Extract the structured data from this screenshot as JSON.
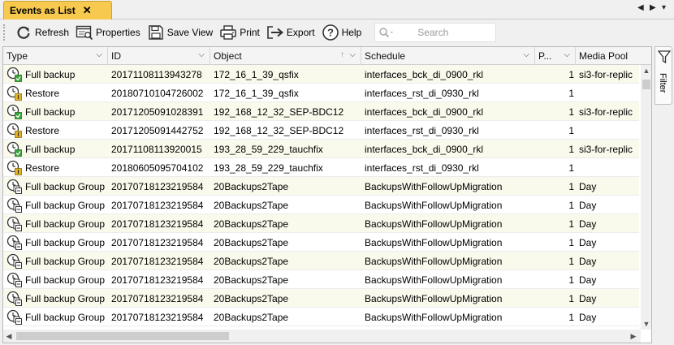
{
  "tab": {
    "title": "Events as List",
    "close_glyph": "✕"
  },
  "tabnav": {
    "prev": "◀",
    "next": "▶",
    "menu": "▾"
  },
  "toolbar": {
    "refresh_label": "Refresh",
    "properties_label": "Properties",
    "save_view_label": "Save View",
    "print_label": "Print",
    "export_label": "Export",
    "help_label": "Help",
    "search_placeholder": "Search"
  },
  "columns": [
    "Type",
    "ID",
    "Object",
    "Schedule",
    "P...",
    "Media Pool"
  ],
  "rows": [
    {
      "type": "Full backup",
      "icon": "backup",
      "id": "20171108113943278",
      "object": "172_16_1_39_qsfix",
      "schedule": "interfaces_bck_di_0900_rkl",
      "p": "1",
      "pool": "si3-for-replic"
    },
    {
      "type": "Restore",
      "icon": "restore",
      "id": "20180710104726002",
      "object": "172_16_1_39_qsfix",
      "schedule": "interfaces_rst_di_0930_rkl",
      "p": "1",
      "pool": ""
    },
    {
      "type": "Full backup",
      "icon": "backup",
      "id": "20171205091028391",
      "object": "192_168_12_32_SEP-BDC12",
      "schedule": "interfaces_bck_di_0900_rkl",
      "p": "1",
      "pool": "si3-for-replic"
    },
    {
      "type": "Restore",
      "icon": "restore",
      "id": "20171205091442752",
      "object": "192_168_12_32_SEP-BDC12",
      "schedule": "interfaces_rst_di_0930_rkl",
      "p": "1",
      "pool": ""
    },
    {
      "type": "Full backup",
      "icon": "backup",
      "id": "20171108113920015",
      "object": "193_28_59_229_tauchfix",
      "schedule": "interfaces_bck_di_0900_rkl",
      "p": "1",
      "pool": "si3-for-replic"
    },
    {
      "type": "Restore",
      "icon": "restore",
      "id": "20180605095704102",
      "object": "193_28_59_229_tauchfix",
      "schedule": "interfaces_rst_di_0930_rkl",
      "p": "1",
      "pool": ""
    },
    {
      "type": "Full backup Group",
      "icon": "group",
      "id": "20170718123219584",
      "object": "20Backups2Tape",
      "schedule": "BackupsWithFollowUpMigration",
      "p": "1",
      "pool": "Day"
    },
    {
      "type": "Full backup Group",
      "icon": "group",
      "id": "20170718123219584",
      "object": "20Backups2Tape",
      "schedule": "BackupsWithFollowUpMigration",
      "p": "1",
      "pool": "Day"
    },
    {
      "type": "Full backup Group",
      "icon": "group",
      "id": "20170718123219584",
      "object": "20Backups2Tape",
      "schedule": "BackupsWithFollowUpMigration",
      "p": "1",
      "pool": "Day"
    },
    {
      "type": "Full backup Group",
      "icon": "group",
      "id": "20170718123219584",
      "object": "20Backups2Tape",
      "schedule": "BackupsWithFollowUpMigration",
      "p": "1",
      "pool": "Day"
    },
    {
      "type": "Full backup Group",
      "icon": "group",
      "id": "20170718123219584",
      "object": "20Backups2Tape",
      "schedule": "BackupsWithFollowUpMigration",
      "p": "1",
      "pool": "Day"
    },
    {
      "type": "Full backup Group",
      "icon": "group",
      "id": "20170718123219584",
      "object": "20Backups2Tape",
      "schedule": "BackupsWithFollowUpMigration",
      "p": "1",
      "pool": "Day"
    },
    {
      "type": "Full backup Group",
      "icon": "group",
      "id": "20170718123219584",
      "object": "20Backups2Tape",
      "schedule": "BackupsWithFollowUpMigration",
      "p": "1",
      "pool": "Day"
    },
    {
      "type": "Full backup Group",
      "icon": "group",
      "id": "20170718123219584",
      "object": "20Backups2Tape",
      "schedule": "BackupsWithFollowUpMigration",
      "p": "1",
      "pool": "Day"
    }
  ],
  "filter_panel": {
    "label": "Filter"
  },
  "colors": {
    "tab_active": "#f7c94e",
    "row_alt": "#f9f9ec",
    "icon_green": "#3aa53a",
    "icon_yellow": "#e3b521"
  }
}
